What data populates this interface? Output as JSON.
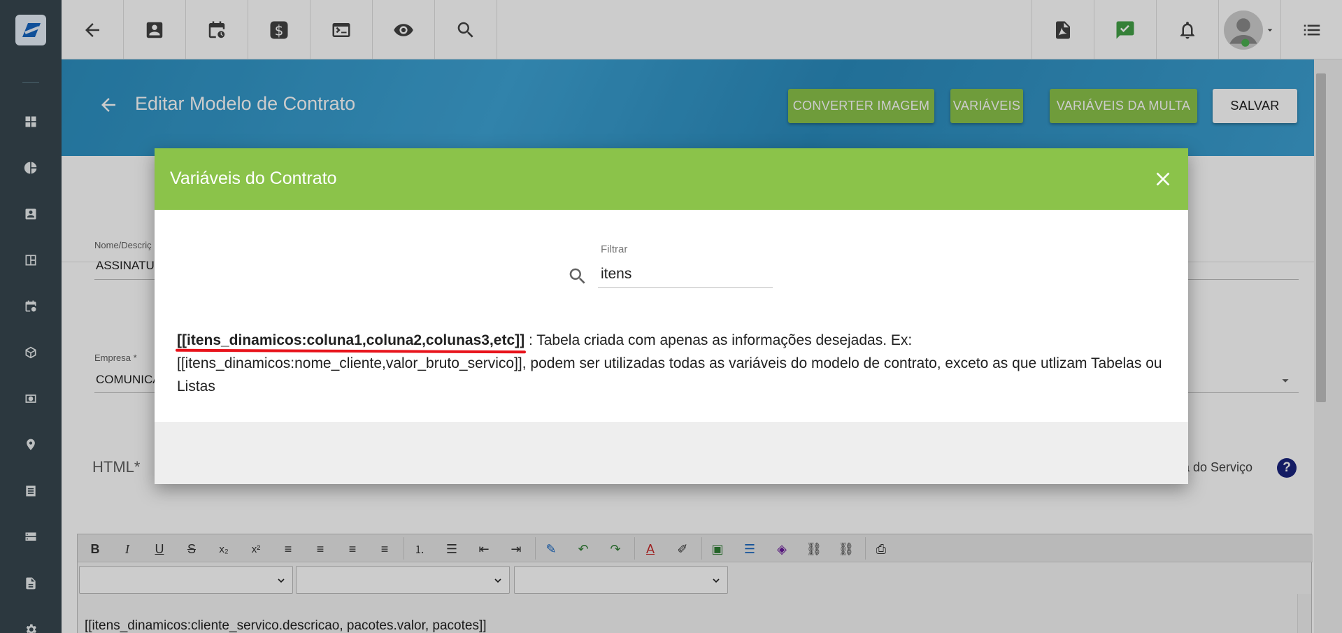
{
  "header": {
    "title": "Editar Modelo de Contrato",
    "buttons": {
      "converter_imagem": "CONVERTER IMAGEM",
      "variaveis": "VARIÁVEIS",
      "variaveis_multa": "VARIÁVEIS DA MULTA",
      "salvar": "SALVAR"
    }
  },
  "form": {
    "nome_label": "Nome/Descriç",
    "nome_value": "ASSINATU",
    "empresa_label": "Empresa *",
    "empresa_value": "COMUNICA",
    "html_label": "HTML*",
    "referencia_label": "ncia do Serviço",
    "help_symbol": "?"
  },
  "editor": {
    "content": "[[itens_dinamicos:cliente_servico.descricao, pacotes.valor, pacotes]]"
  },
  "modal": {
    "title": "Variáveis do Contrato",
    "filter_label": "Filtrar",
    "filter_value": "itens",
    "variable": {
      "name": "[[itens_dinamicos:coluna1,coluna2,colunas3,etc]]",
      "description": " : Tabela criada com apenas as informações desejadas. Ex: [[itens_dinamicos:nome_cliente,valor_bruto_servico]], podem ser utilizadas todas as variáveis do modelo de contrato, exceto as que utlizam Tabelas ou Listas"
    }
  },
  "colors": {
    "accent_green": "#8bc34a",
    "hero_blue": "#2c8fc0",
    "sidebar": "#37474f",
    "highlight_red": "#e8141c"
  }
}
